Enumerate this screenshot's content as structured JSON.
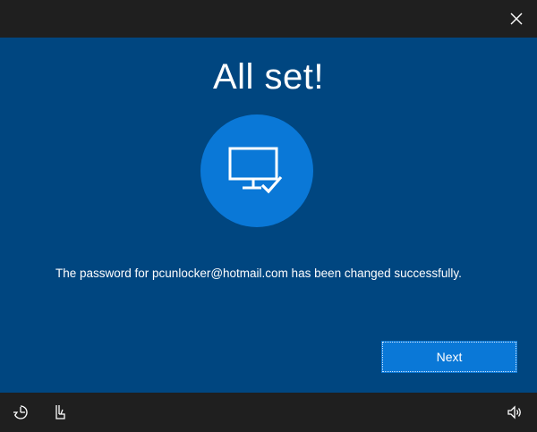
{
  "window": {
    "close_icon": "close-icon"
  },
  "main": {
    "title": "All set!",
    "hero_icon": "monitor-check-icon",
    "message": "The password for pcunlocker@hotmail.com has been changed successfully.",
    "next_label": "Next"
  },
  "bottombar": {
    "left_icons": [
      "ease-of-access-icon",
      "on-screen-keyboard-icon"
    ],
    "right_icons": [
      "volume-icon"
    ]
  },
  "colors": {
    "background_dark": "#1f1f1f",
    "panel_blue": "#004680",
    "accent_blue": "#0a78d7",
    "text": "#ffffff"
  }
}
